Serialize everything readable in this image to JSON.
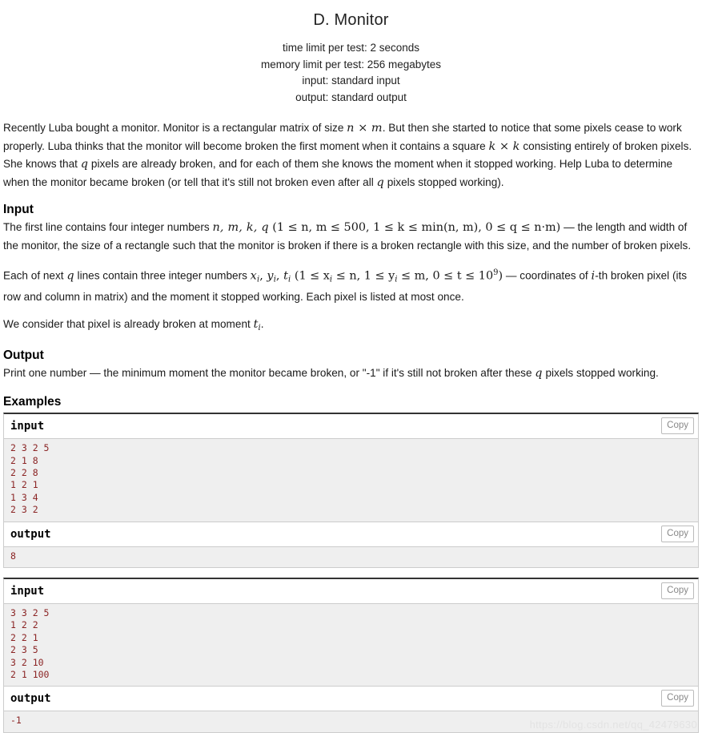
{
  "header": {
    "title": "D. Monitor",
    "properties": [
      "time limit per test: 2 seconds",
      "memory limit per test: 256 megabytes",
      "input: standard input",
      "output: standard output"
    ]
  },
  "statement": {
    "p1_a": "Recently Luba bought a monitor. Monitor is a rectangular matrix of size ",
    "p1_n": "n",
    "p1_times1": " × ",
    "p1_m": "m",
    "p1_b": ". But then she started to notice that some pixels cease to work properly. Luba thinks that the monitor will become broken the first moment when it contains a square ",
    "p1_k1": "k",
    "p1_times2": " × ",
    "p1_k2": "k",
    "p1_c": " consisting entirely of broken pixels. She knows that ",
    "p1_q1": "q",
    "p1_d": " pixels are already broken, and for each of them she knows the moment when it stopped working. Help Luba to determine when the monitor became broken (or tell that it's still not broken even after all ",
    "p1_q2": "q",
    "p1_e": " pixels stopped working)."
  },
  "input_section": {
    "heading": "Input",
    "p1_a": "The first line contains four integer numbers ",
    "p1_vars": "n, m, k, q",
    "p1_constraint": " (1 ≤ n, m ≤ 500, 1 ≤ k ≤ min(n, m), 0 ≤ q ≤ n·m)",
    "p1_b": " — the length and width of the monitor, the size of a rectangle such that the monitor is broken if there is a broken rectangle with this size, and the number of broken pixels.",
    "p2_a": "Each of next ",
    "p2_q": "q",
    "p2_b": " lines contain three integer numbers ",
    "p2_x": "x",
    "p2_xs": "i",
    "p2_comma1": ", ",
    "p2_y": "y",
    "p2_ys": "i",
    "p2_comma2": ", ",
    "p2_t": "t",
    "p2_ts": "i",
    "p2_constraint_open": " (1 ≤ x",
    "p2_c_xs": "i",
    "p2_constraint_mid1": " ≤ n, 1 ≤ y",
    "p2_c_ys": "i",
    "p2_constraint_mid2": " ≤ m, 0 ≤ t ≤ 10",
    "p2_c_sup": "9",
    "p2_constraint_close": ")",
    "p2_c": " — coordinates of ",
    "p2_i": "i",
    "p2_d": "-th broken pixel (its row and column in matrix) and the moment it stopped working. Each pixel is listed at most once.",
    "p3_a": "We consider that pixel is already broken at moment ",
    "p3_t": "t",
    "p3_ts": "i",
    "p3_b": "."
  },
  "output_section": {
    "heading": "Output",
    "p1_a": "Print one number — the minimum moment the monitor became broken, or \"-1\" if it's still not broken after these ",
    "p1_q": "q",
    "p1_b": " pixels stopped working."
  },
  "examples": {
    "heading": "Examples",
    "copy_label": "Copy",
    "tests": [
      {
        "input_label": "input",
        "input_text": "2 3 2 5\n2 1 8\n2 2 8\n1 2 1\n1 3 4\n2 3 2",
        "output_label": "output",
        "output_text": "8"
      },
      {
        "input_label": "input",
        "input_text": "3 3 2 5\n1 2 2\n2 2 1\n2 3 5\n3 2 10\n2 1 100",
        "output_label": "output",
        "output_text": "-1"
      }
    ]
  },
  "watermark": "https://blog.csdn.net/qq_42479630"
}
